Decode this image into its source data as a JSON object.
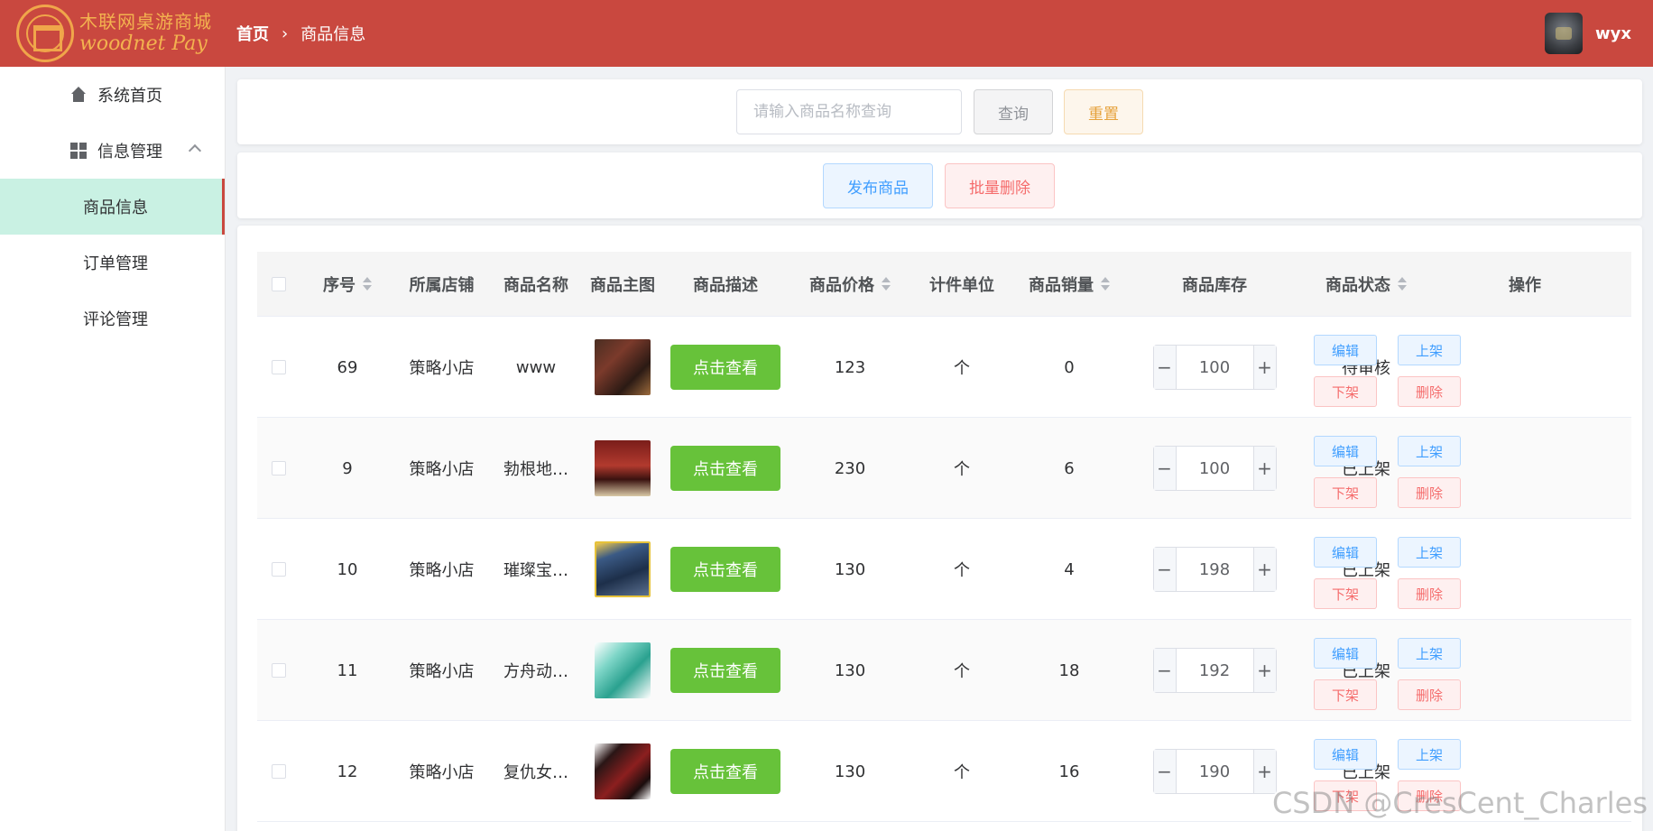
{
  "header": {
    "logo_cn": "木联网桌游商城",
    "logo_en": "woodnet Pay",
    "breadcrumb_home": "首页",
    "breadcrumb_current": "商品信息",
    "username": "wyx",
    "bg_color": "#c9483f"
  },
  "sidebar": {
    "items": [
      {
        "label": "系统首页",
        "icon": "home-icon"
      },
      {
        "label": "信息管理",
        "icon": "grid-icon",
        "expanded": true
      },
      {
        "label": "商品信息",
        "active": true
      },
      {
        "label": "订单管理"
      },
      {
        "label": "评论管理"
      }
    ]
  },
  "search": {
    "placeholder": "请输入商品名称查询",
    "query_label": "查询",
    "reset_label": "重置"
  },
  "actions": {
    "publish_label": "发布商品",
    "batch_delete_label": "批量删除"
  },
  "table": {
    "columns": [
      "序号",
      "所属店铺",
      "商品名称",
      "商品主图",
      "商品描述",
      "商品价格",
      "计件单位",
      "商品销量",
      "商品库存",
      "商品状态",
      "操作"
    ],
    "view_label": "点击查看",
    "op_labels": {
      "edit": "编辑",
      "up": "上架",
      "down": "下架",
      "del": "删除"
    },
    "rows": [
      {
        "id": "69",
        "shop": "策略小店",
        "name": "www",
        "price": "123",
        "unit": "个",
        "sales": "0",
        "stock": "100",
        "status": "待审核"
      },
      {
        "id": "9",
        "shop": "策略小店",
        "name": "勃根地…",
        "price": "230",
        "unit": "个",
        "sales": "6",
        "stock": "100",
        "status": "已上架"
      },
      {
        "id": "10",
        "shop": "策略小店",
        "name": "璀璨宝…",
        "price": "130",
        "unit": "个",
        "sales": "4",
        "stock": "198",
        "status": "已上架"
      },
      {
        "id": "11",
        "shop": "策略小店",
        "name": "方舟动…",
        "price": "130",
        "unit": "个",
        "sales": "18",
        "stock": "192",
        "status": "已上架"
      },
      {
        "id": "12",
        "shop": "策略小店",
        "name": "复仇女…",
        "price": "130",
        "unit": "个",
        "sales": "16",
        "stock": "190",
        "status": "已上架"
      }
    ]
  },
  "stepper": {
    "minus": "−",
    "plus": "+"
  },
  "watermark": "CSDN @CresCent_Charles"
}
